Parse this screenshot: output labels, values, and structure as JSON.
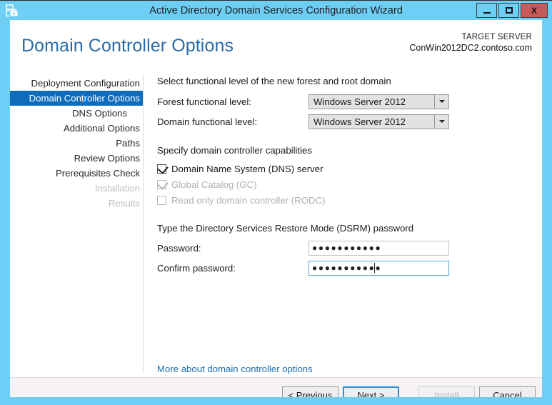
{
  "window": {
    "title": "Active Directory Domain Services Configuration Wizard",
    "icon": "server-wizard-icon",
    "minimize_label": "Minimize",
    "maximize_label": "Maximize",
    "close_label": "X",
    "titlebar_color": "#6dcff6",
    "close_button_color": "#c75b5b"
  },
  "header": {
    "page_title": "Domain Controller Options",
    "target_server_label": "TARGET SERVER",
    "target_server_name": "ConWin2012DC2.contoso.com",
    "title_color": "#2a6ca8"
  },
  "sidebar": {
    "selected_color": "#0f6cbd",
    "items": [
      {
        "label": "Deployment Configuration",
        "state": "enabled",
        "indent": false
      },
      {
        "label": "Domain Controller Options",
        "state": "selected",
        "indent": false
      },
      {
        "label": "DNS Options",
        "state": "enabled",
        "indent": true
      },
      {
        "label": "Additional Options",
        "state": "enabled",
        "indent": false
      },
      {
        "label": "Paths",
        "state": "enabled",
        "indent": false
      },
      {
        "label": "Review Options",
        "state": "enabled",
        "indent": false
      },
      {
        "label": "Prerequisites Check",
        "state": "enabled",
        "indent": false
      },
      {
        "label": "Installation",
        "state": "disabled",
        "indent": false
      },
      {
        "label": "Results",
        "state": "disabled",
        "indent": false
      }
    ]
  },
  "main": {
    "functional_level_heading": "Select functional level of the new forest and root domain",
    "forest_level_label": "Forest functional level:",
    "forest_level_value": "Windows Server 2012",
    "domain_level_label": "Domain functional level:",
    "domain_level_value": "Windows Server 2012",
    "capabilities_heading": "Specify domain controller capabilities",
    "capabilities": [
      {
        "label": "Domain Name System (DNS) server",
        "checked": true,
        "enabled": true
      },
      {
        "label": "Global Catalog (GC)",
        "checked": true,
        "enabled": false
      },
      {
        "label": "Read only domain controller (RODC)",
        "checked": false,
        "enabled": false
      }
    ],
    "dsrm_heading": "Type the Directory Services Restore Mode (DSRM) password",
    "password_label": "Password:",
    "password_value": "●●●●●●●●●●●",
    "confirm_password_label": "Confirm password:",
    "confirm_password_value": "●●●●●●●●●●●",
    "more_link": "More about domain controller options",
    "link_color": "#1b6fb5"
  },
  "footer": {
    "previous_label": "< Previous",
    "next_label": "Next >",
    "install_label": "Install",
    "cancel_label": "Cancel",
    "install_enabled": false,
    "focused_button": "Next >"
  }
}
